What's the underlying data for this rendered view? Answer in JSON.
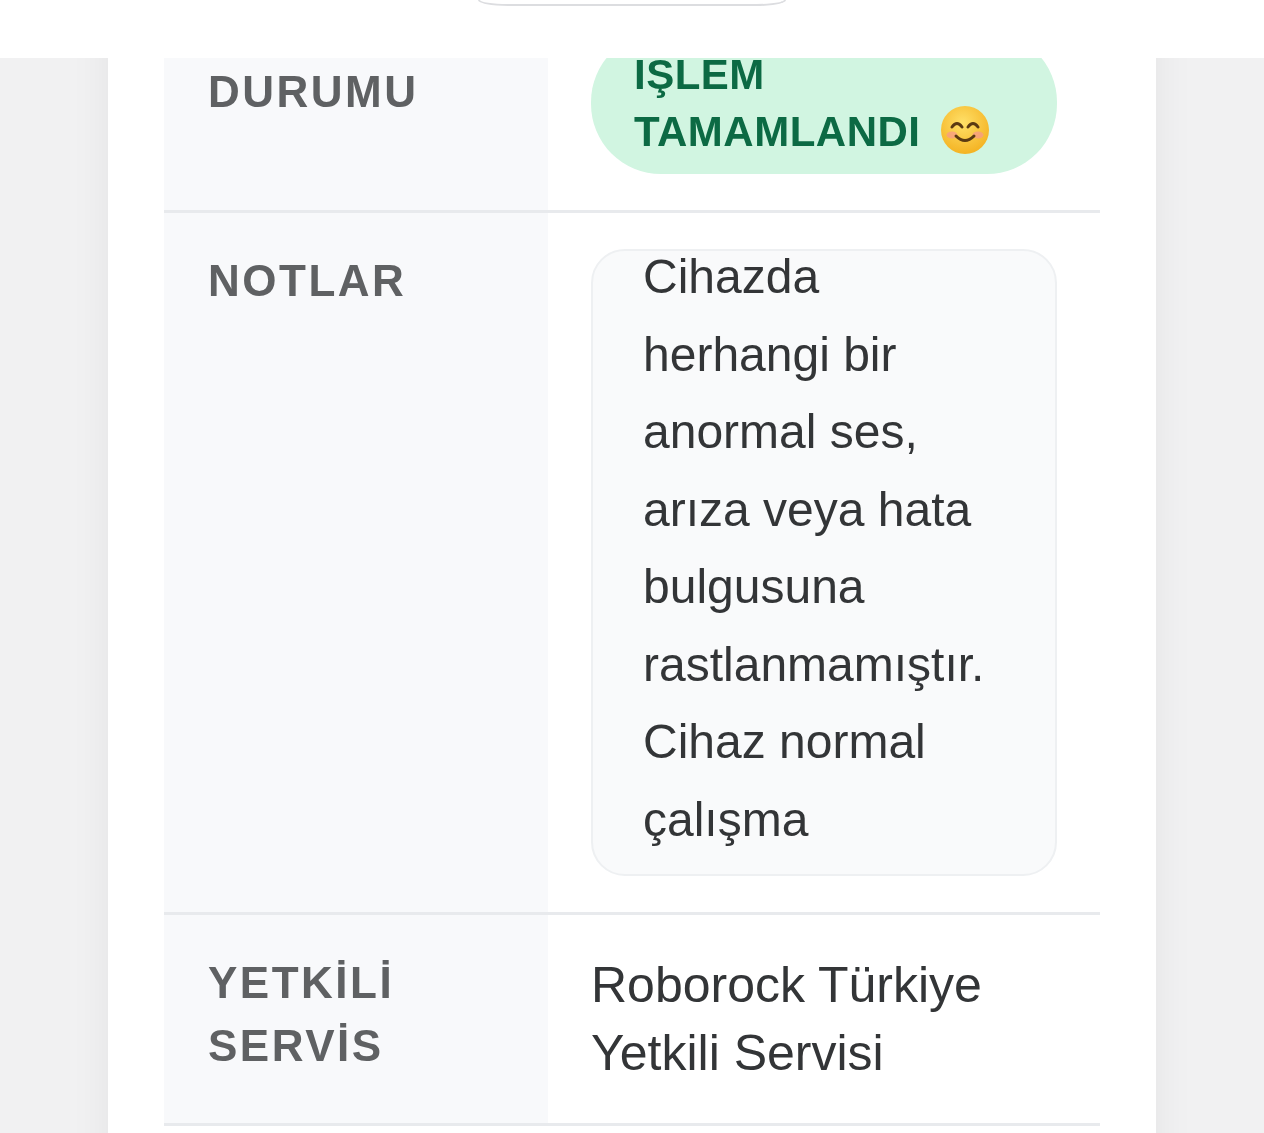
{
  "details": {
    "rows": [
      {
        "kind": "status",
        "label": "DURUMU",
        "badge": {
          "text": "İŞLEM TAMAMLANDI"
        }
      },
      {
        "kind": "notes",
        "label": "NOTLAR",
        "text": "Cihazda herhangi bir anormal ses, arıza veya hata bulgusuna rastlanmamıştır. Cihaz normal çalışma"
      },
      {
        "kind": "text",
        "label": "YETKİLİ SERVİS",
        "value": "Roborock Türkiye Yetkili Servisi"
      }
    ]
  }
}
